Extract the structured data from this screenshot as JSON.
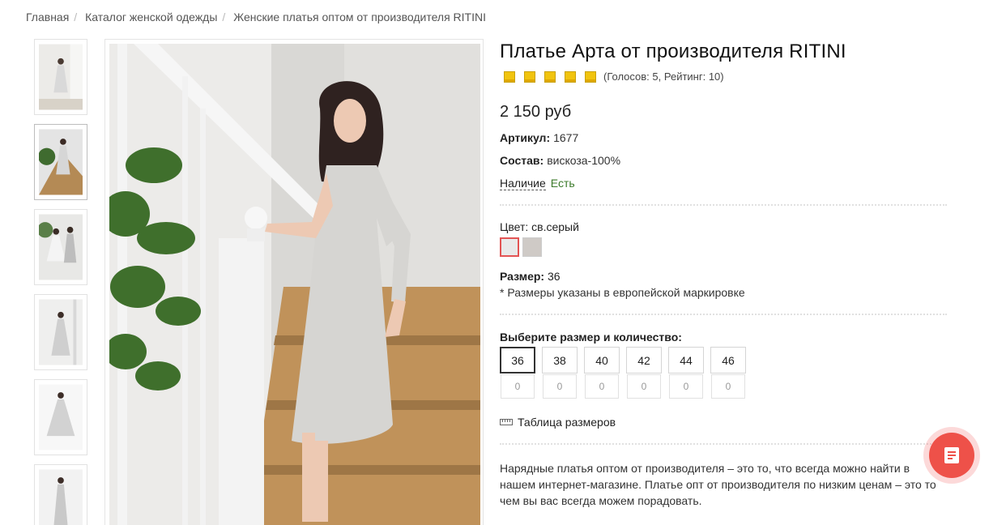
{
  "breadcrumb": {
    "home": "Главная",
    "catalog": "Каталог женской одежды",
    "current": "Женские платья оптом от производителя RITINI"
  },
  "product": {
    "title": "Платье Арта от производителя RITINI",
    "rating_stars": 5,
    "rating_text": "(Голосов: 5, Рейтинг: 10)",
    "price": "2 150 руб",
    "article_label": "Артикул:",
    "article_value": "1677",
    "composition_label": "Состав:",
    "composition_value": "вискоза-100%",
    "availability_label": "Наличие",
    "availability_value": "Есть",
    "color_label": "Цвет:",
    "color_value": "св.серый",
    "swatches": [
      "#e9e9e9",
      "#cfcac6"
    ],
    "size_label": "Размер:",
    "size_value": "36",
    "size_note": "* Размеры указаны в европейской маркировке",
    "choose_label": "Выберите размер и количество:",
    "sizes": [
      {
        "size": "36",
        "qty": "0"
      },
      {
        "size": "38",
        "qty": "0"
      },
      {
        "size": "40",
        "qty": "0"
      },
      {
        "size": "42",
        "qty": "0"
      },
      {
        "size": "44",
        "qty": "0"
      },
      {
        "size": "46",
        "qty": "0"
      }
    ],
    "size_table_link": "Таблица размеров",
    "description": "Нарядные платья оптом от производителя – это то, что всегда можно найти в нашем интернет-магазине. Платье опт от производителя по низким ценам – это то чем вы вас всегда можем порадовать."
  },
  "colors": {
    "accent": "#ee5149",
    "star": "#f1c40f",
    "available": "#3b7a2a"
  },
  "icons": {
    "ruler": "ruler-icon",
    "fab": "document-icon"
  }
}
